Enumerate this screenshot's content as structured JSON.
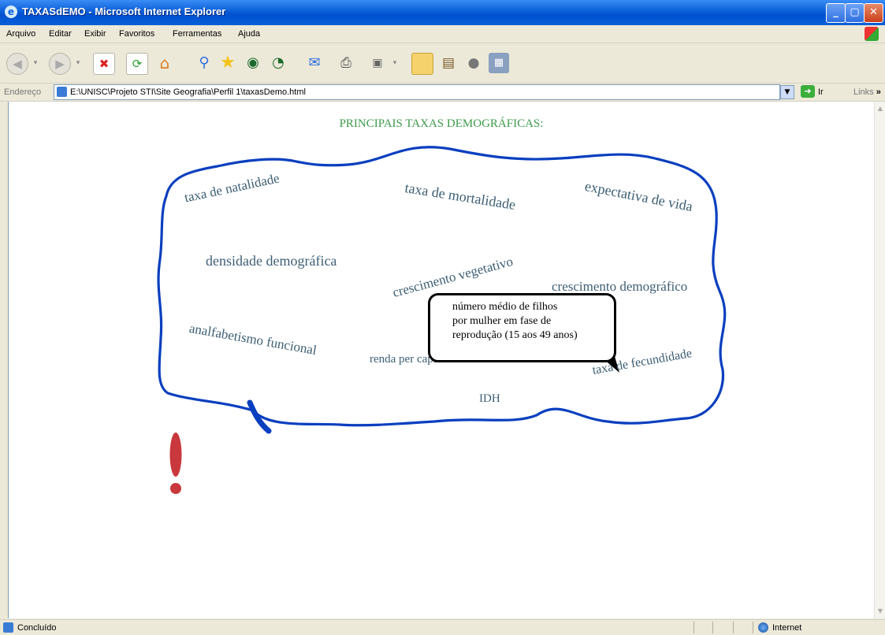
{
  "window": {
    "title": "TAXASdEMO - Microsoft Internet Explorer"
  },
  "menu": {
    "items": [
      "Arquivo",
      "Editar",
      "Exibir",
      "Favoritos",
      "Ferramentas",
      "Ajuda"
    ]
  },
  "address_bar": {
    "label": "Endereço",
    "url": "E:\\UNISC\\Projeto STI\\Site Geografia\\Perfil 1\\taxasDemo.html",
    "go_label": "Ir",
    "links_label": "Links",
    "more_glyph": "»"
  },
  "page": {
    "heading": "PRINCIPAIS TAXAS DEMOGRÁFICAS:",
    "terms": {
      "natalidade": "taxa de natalidade",
      "mortalidade": "taxa de mortalidade",
      "expectativa": "expectativa de vida",
      "densidade": "densidade demográfica",
      "vegetativo": "crescimento vegetativo",
      "demografico": "crescimento demográfico",
      "analfabetismo": "analfabetismo funcional",
      "renda": "renda per capita",
      "fecundidade": "taxa de fecundidade",
      "idh": "IDH"
    },
    "tooltip": {
      "line1": "número médio de filhos",
      "line2": "por mulher  em fase de",
      "line3": "reprodução (15 aos 49 anos)"
    }
  },
  "status_bar": {
    "text": "Concluído",
    "zone": "Internet"
  },
  "colors": {
    "cloud_outline": "#0a3fbf",
    "heading": "#3c9b4a",
    "terms": "#3d5f74",
    "exclamation": "#c9383c",
    "titlebar": "#0a5fd8"
  },
  "icons": [
    "back-icon",
    "forward-icon",
    "stop-icon",
    "refresh-icon",
    "home-icon",
    "search-icon",
    "favorites-icon",
    "media-icon",
    "history-icon",
    "mail-icon",
    "print-icon",
    "edit-icon",
    "folder-icon",
    "research-icon",
    "messenger-icon",
    "calculator-icon"
  ]
}
